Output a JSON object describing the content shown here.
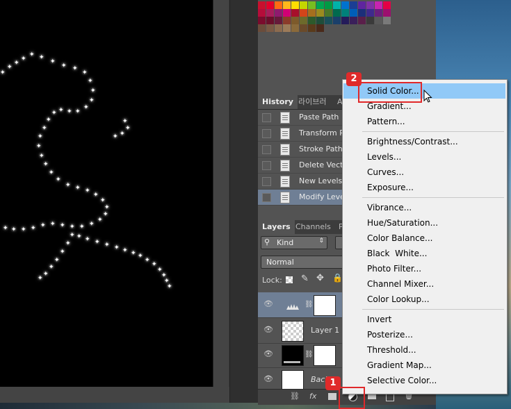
{
  "colors": {
    "menu_highlight": "#91c9f7",
    "selected_row": "#6f7f95",
    "annotation_red": "#e02a2a"
  },
  "history_panel": {
    "tabs": [
      "History",
      "라이브러",
      "A"
    ],
    "items": [
      {
        "label": "Paste Path",
        "selected": false
      },
      {
        "label": "Transform P",
        "selected": false
      },
      {
        "label": "Stroke Path",
        "selected": false
      },
      {
        "label": "Delete Vecto",
        "selected": false
      },
      {
        "label": "New Levels",
        "selected": false
      },
      {
        "label": "Modify Leve",
        "selected": true
      }
    ]
  },
  "layers_panel": {
    "tabs": [
      "Layers",
      "Channels",
      "P"
    ],
    "filter_label": "Kind",
    "blend_mode": "Normal",
    "lock_label": "Lock:",
    "layers": [
      {
        "name": "",
        "selected": true
      },
      {
        "name": "Layer 1",
        "selected": false
      },
      {
        "name": "",
        "selected": false
      },
      {
        "name": "Backg",
        "selected": false
      }
    ],
    "bottom_buttons": [
      "link-icon",
      "fx",
      "mask-icon",
      "adjustment-icon",
      "folder-icon",
      "new-layer-icon",
      "trash-icon"
    ]
  },
  "menu": {
    "groups": [
      [
        "Solid Color...",
        "Gradient...",
        "Pattern..."
      ],
      [
        "Brightness/Contrast...",
        "Levels...",
        "Curves...",
        "Exposure..."
      ],
      [
        "Vibrance...",
        "Hue/Saturation...",
        "Color Balance...",
        "Black  White...",
        "Photo Filter...",
        "Channel Mixer...",
        "Color Lookup..."
      ],
      [
        "Invert",
        "Posterize...",
        "Threshold...",
        "Gradient Map...",
        "Selective Color..."
      ]
    ],
    "highlighted": "Solid Color..."
  },
  "annotations": {
    "step1": "1",
    "step2": "2"
  }
}
